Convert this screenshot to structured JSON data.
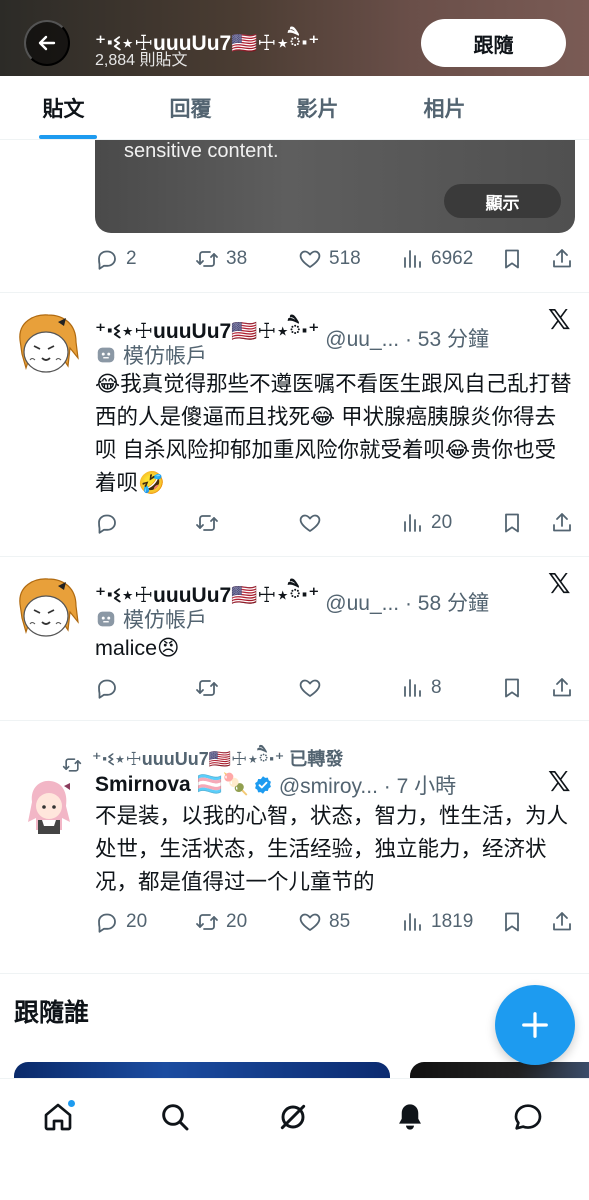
{
  "header": {
    "name": "⁺‧ଽ⋆☩uuuUu7🇺🇸☩⋆ཻ‧⁺",
    "post_count": "2,884 則貼文",
    "follow_label": "跟隨"
  },
  "tabs": [
    {
      "label": "貼文",
      "active": true
    },
    {
      "label": "回覆",
      "active": false
    },
    {
      "label": "影片",
      "active": false
    },
    {
      "label": "相片",
      "active": false
    }
  ],
  "media": {
    "text": "sensitive content.",
    "show_label": "顯示"
  },
  "tweet0_actions": {
    "replies": "2",
    "reposts": "38",
    "likes": "518",
    "views": "6962"
  },
  "tweets": [
    {
      "name": "⁺‧ଽ⋆☩uuuUu7🇺🇸☩⋆ཻ‧⁺",
      "meta": "@uu_... · 53 分鐘",
      "label": "模仿帳戶",
      "body": "😂我真觉得那些不遵医嘱不看医生跟风自己乱打替西的人是傻逼而且找死😂 甲状腺癌胰腺炎你得去呗 自杀风险抑郁加重风险你就受着呗😂贵你也受着呗🤣",
      "views": "20"
    },
    {
      "name": "⁺‧ଽ⋆☩uuuUu7🇺🇸☩⋆ཻ‧⁺",
      "meta": "@uu_... · 58 分鐘",
      "label": "模仿帳戶",
      "body": "malice😠",
      "views": "8"
    },
    {
      "retweeted_by": "⁺‧ଽ⋆☩uuuUu7🇺🇸☩⋆ཻ‧⁺ 已轉發",
      "name": "Smirnova 🏳️‍⚧️🍡",
      "meta": "@smiroy... · 7 小時",
      "body": "不是装，以我的心智，状态，智力，性生活，为人处世，生活状态，生活经验，独立能力，经济状况，都是值得过一个儿童节的",
      "replies": "20",
      "reposts": "20",
      "likes": "85",
      "views": "1819"
    }
  ],
  "who_to_follow": {
    "title": "跟隨誰"
  },
  "colors": {
    "accent": "#1d9bf0",
    "text": "#0f1419",
    "muted": "#536471"
  },
  "nav_icons": [
    "home-icon",
    "search-icon",
    "grok-icon",
    "notifications-icon",
    "messages-icon"
  ]
}
